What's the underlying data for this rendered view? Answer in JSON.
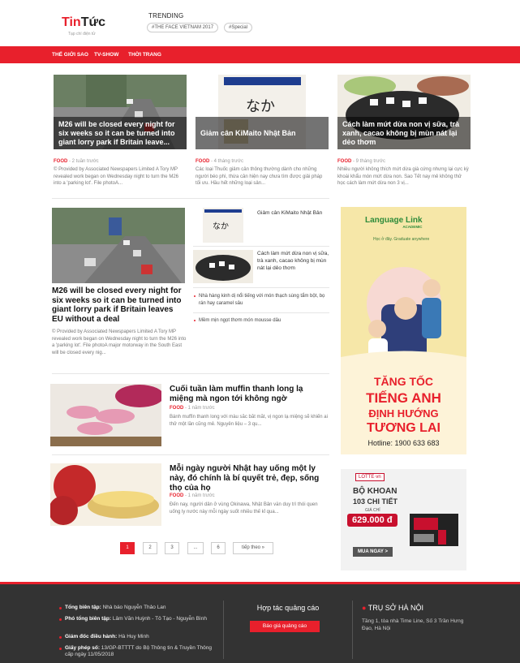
{
  "header": {
    "logo_red": "Tin",
    "logo_black": "Tức",
    "logo_sub": "Tạp chí điện tử",
    "trending_title": "TRENDING",
    "tags": [
      "#THE FACE VIETNAM 2017",
      "#Special"
    ]
  },
  "nav": {
    "items": [
      "THẾ GIỚI SAO",
      "TV-SHOW",
      "THỜI TRANG"
    ]
  },
  "top_cards": [
    {
      "title": "M26 will be closed every night for six weeks so it can be turned into giant lorry park if Britain leave...",
      "category": "FOOD",
      "time": "- 2 tuần trước",
      "excerpt": "© Provided by Associated Newspapers Limited A Tory MP revealed work began on Wednesday night to turn the M26 into a 'parking lot'. File photoA..."
    },
    {
      "title": "Giảm cân KiMaito Nhật Bản",
      "category": "FOOD",
      "time": "- 4 tháng trước",
      "excerpt": "Các loại Thuốc giảm cân thông thường dành cho những người béo phì, thừa cân hiện nay chưa tìm được giải pháp tối ưu. Hầu hết những loại sản..."
    },
    {
      "title": "Cách làm mứt dừa non vị sữa, trà xanh, cacao không bị mùn nát lại dẻo thơm",
      "category": "FOOD",
      "time": "- 9 tháng trước",
      "excerpt": "Nhiều người không thích mứt dừa già cứng nhưng lại cực kỳ khoái khẩu món mứt dừa non. Sao Tết nay mẻ không thử học cách làm mứt dừa non 3 vị..."
    }
  ],
  "feature": {
    "title": "M26 will be closed every night for six weeks so it can be turned into giant lorry park if Britain leaves EU without a deal",
    "excerpt": "© Provided by Associated Newspapers Limited A Tory MP revealed work began on Wednesday night to turn the M26 into a 'parking lot'. File photoA major motorway in the South East will be closed every nig..."
  },
  "side_list": [
    {
      "title": "Giảm cân KiMaito Nhật Bản"
    },
    {
      "title": "Cách làm mứt dừa non vị sữa, trà xanh, cacao không bị mùn nát lại dẻo thơm"
    }
  ],
  "bullets": [
    "Nhà hàng kinh dị nổi tiếng với món thạch sùng tẩm bột, bọ rán hay caramel sâu",
    "Mềm mịn ngọt thơm món mousse dâu"
  ],
  "list_articles": [
    {
      "title": "Cuối tuần làm muffin thanh long lạ miệng mà ngon tới không ngờ",
      "category": "FOOD",
      "time": "- 1 năm trước",
      "excerpt": "Bánh muffin thanh long với màu sắc bắt mắt, vị ngon lạ miệng sẽ khiến ai thử một lần cũng mê. Nguyên liệu – 3 qu..."
    },
    {
      "title": "Mỗi ngày người Nhật hay uống một ly này, đó chính là bí quyết trẻ, đẹp, sống thọ của họ",
      "category": "FOOD",
      "time": "- 1 năm trước",
      "excerpt": "Đến nay, người dân ở vùng Okinawa, Nhật Bản vẫn duy trì thói quen uống ly nước này mỗi ngày suốt nhiều thế kỉ qua..."
    }
  ],
  "ad1": {
    "brand": "Language Link",
    "brand_sub": "ACADEMIC",
    "slogan": "Học ở đây. Graduate anywhere",
    "line1": "TĂNG TỐC",
    "line2": "TIẾNG ANH",
    "line3": "ĐỊNH HƯỚNG",
    "line4": "TƯƠNG LAI",
    "hotline": "Hotline: 1900 633 683"
  },
  "ad2": {
    "brand": "LOTTE·vn",
    "line1": "BỘ KHOAN",
    "line2": "103 CHI TIẾT",
    "line3": "GIÁ CHỈ",
    "price": "629.000 đ",
    "cta": "MUA NGAY >"
  },
  "pagination": {
    "pages": [
      "1",
      "2",
      "3",
      "...",
      "6"
    ],
    "next": "tiếp theo »"
  },
  "footer": {
    "items": [
      {
        "label": "Tổng biên tập:",
        "value": "Nhà báo Nguyễn Thảo Lan"
      },
      {
        "label": "Phó tổng biên tập:",
        "value": "Lâm Văn Huỳnh - Tô Tạo - Nguyễn Bình"
      },
      {
        "label": "Giám đốc điều hành:",
        "value": "Hà Huy Minh"
      },
      {
        "label": "Giấy phép số:",
        "value": "13/GP-BTTTT do Bộ Thông tin & Truyền Thông cấp ngày 11/05/2018"
      }
    ],
    "coop_title": "Hợp tác quảng cáo",
    "coop_button": "Báo giá quảng cáo",
    "office_title": "TRỤ SỞ HÀ NỘI",
    "office_address": "Tầng 1, tòa nhà Time Line, Số 3 Trần Hưng Đạo, Hà Nội"
  }
}
